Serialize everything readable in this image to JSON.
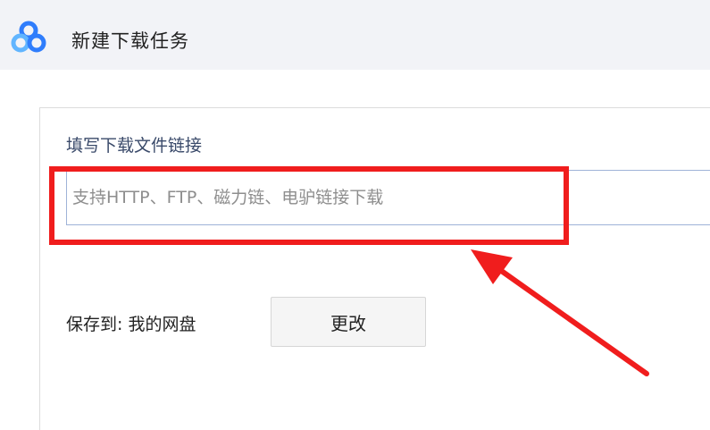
{
  "dialog": {
    "app_icon": "baidu-netdisk-cloud-icon",
    "title": "新建下载任务"
  },
  "link_section": {
    "label": "填写下载文件链接",
    "input_value": "",
    "input_placeholder": "支持HTTP、FTP、磁力链、电驴链接下载"
  },
  "save_section": {
    "label": "保存到: 我的网盘",
    "change_button_label": "更改"
  },
  "annotation": {
    "color": "#f01d1d",
    "highlight": "link-input",
    "arrow_icon": "red-arrow-icon"
  },
  "colors": {
    "titlebar_bg": "#f2f3f7",
    "logo_blue": "#2f7dfc",
    "logo_light": "#61b5ff",
    "input_border": "#9fb3d8"
  }
}
